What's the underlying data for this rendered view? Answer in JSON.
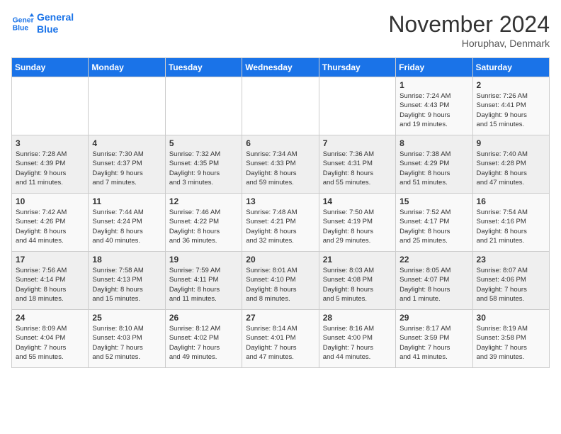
{
  "logo": {
    "line1": "General",
    "line2": "Blue"
  },
  "title": "November 2024",
  "subtitle": "Horuphav, Denmark",
  "days_of_week": [
    "Sunday",
    "Monday",
    "Tuesday",
    "Wednesday",
    "Thursday",
    "Friday",
    "Saturday"
  ],
  "weeks": [
    [
      {
        "day": "",
        "info": ""
      },
      {
        "day": "",
        "info": ""
      },
      {
        "day": "",
        "info": ""
      },
      {
        "day": "",
        "info": ""
      },
      {
        "day": "",
        "info": ""
      },
      {
        "day": "1",
        "info": "Sunrise: 7:24 AM\nSunset: 4:43 PM\nDaylight: 9 hours\nand 19 minutes."
      },
      {
        "day": "2",
        "info": "Sunrise: 7:26 AM\nSunset: 4:41 PM\nDaylight: 9 hours\nand 15 minutes."
      }
    ],
    [
      {
        "day": "3",
        "info": "Sunrise: 7:28 AM\nSunset: 4:39 PM\nDaylight: 9 hours\nand 11 minutes."
      },
      {
        "day": "4",
        "info": "Sunrise: 7:30 AM\nSunset: 4:37 PM\nDaylight: 9 hours\nand 7 minutes."
      },
      {
        "day": "5",
        "info": "Sunrise: 7:32 AM\nSunset: 4:35 PM\nDaylight: 9 hours\nand 3 minutes."
      },
      {
        "day": "6",
        "info": "Sunrise: 7:34 AM\nSunset: 4:33 PM\nDaylight: 8 hours\nand 59 minutes."
      },
      {
        "day": "7",
        "info": "Sunrise: 7:36 AM\nSunset: 4:31 PM\nDaylight: 8 hours\nand 55 minutes."
      },
      {
        "day": "8",
        "info": "Sunrise: 7:38 AM\nSunset: 4:29 PM\nDaylight: 8 hours\nand 51 minutes."
      },
      {
        "day": "9",
        "info": "Sunrise: 7:40 AM\nSunset: 4:28 PM\nDaylight: 8 hours\nand 47 minutes."
      }
    ],
    [
      {
        "day": "10",
        "info": "Sunrise: 7:42 AM\nSunset: 4:26 PM\nDaylight: 8 hours\nand 44 minutes."
      },
      {
        "day": "11",
        "info": "Sunrise: 7:44 AM\nSunset: 4:24 PM\nDaylight: 8 hours\nand 40 minutes."
      },
      {
        "day": "12",
        "info": "Sunrise: 7:46 AM\nSunset: 4:22 PM\nDaylight: 8 hours\nand 36 minutes."
      },
      {
        "day": "13",
        "info": "Sunrise: 7:48 AM\nSunset: 4:21 PM\nDaylight: 8 hours\nand 32 minutes."
      },
      {
        "day": "14",
        "info": "Sunrise: 7:50 AM\nSunset: 4:19 PM\nDaylight: 8 hours\nand 29 minutes."
      },
      {
        "day": "15",
        "info": "Sunrise: 7:52 AM\nSunset: 4:17 PM\nDaylight: 8 hours\nand 25 minutes."
      },
      {
        "day": "16",
        "info": "Sunrise: 7:54 AM\nSunset: 4:16 PM\nDaylight: 8 hours\nand 21 minutes."
      }
    ],
    [
      {
        "day": "17",
        "info": "Sunrise: 7:56 AM\nSunset: 4:14 PM\nDaylight: 8 hours\nand 18 minutes."
      },
      {
        "day": "18",
        "info": "Sunrise: 7:58 AM\nSunset: 4:13 PM\nDaylight: 8 hours\nand 15 minutes."
      },
      {
        "day": "19",
        "info": "Sunrise: 7:59 AM\nSunset: 4:11 PM\nDaylight: 8 hours\nand 11 minutes."
      },
      {
        "day": "20",
        "info": "Sunrise: 8:01 AM\nSunset: 4:10 PM\nDaylight: 8 hours\nand 8 minutes."
      },
      {
        "day": "21",
        "info": "Sunrise: 8:03 AM\nSunset: 4:08 PM\nDaylight: 8 hours\nand 5 minutes."
      },
      {
        "day": "22",
        "info": "Sunrise: 8:05 AM\nSunset: 4:07 PM\nDaylight: 8 hours\nand 1 minute."
      },
      {
        "day": "23",
        "info": "Sunrise: 8:07 AM\nSunset: 4:06 PM\nDaylight: 7 hours\nand 58 minutes."
      }
    ],
    [
      {
        "day": "24",
        "info": "Sunrise: 8:09 AM\nSunset: 4:04 PM\nDaylight: 7 hours\nand 55 minutes."
      },
      {
        "day": "25",
        "info": "Sunrise: 8:10 AM\nSunset: 4:03 PM\nDaylight: 7 hours\nand 52 minutes."
      },
      {
        "day": "26",
        "info": "Sunrise: 8:12 AM\nSunset: 4:02 PM\nDaylight: 7 hours\nand 49 minutes."
      },
      {
        "day": "27",
        "info": "Sunrise: 8:14 AM\nSunset: 4:01 PM\nDaylight: 7 hours\nand 47 minutes."
      },
      {
        "day": "28",
        "info": "Sunrise: 8:16 AM\nSunset: 4:00 PM\nDaylight: 7 hours\nand 44 minutes."
      },
      {
        "day": "29",
        "info": "Sunrise: 8:17 AM\nSunset: 3:59 PM\nDaylight: 7 hours\nand 41 minutes."
      },
      {
        "day": "30",
        "info": "Sunrise: 8:19 AM\nSunset: 3:58 PM\nDaylight: 7 hours\nand 39 minutes."
      }
    ]
  ],
  "colors": {
    "header_bg": "#1a73e8",
    "header_text": "#ffffff",
    "odd_row": "#f9f9f9",
    "even_row": "#efefef"
  }
}
